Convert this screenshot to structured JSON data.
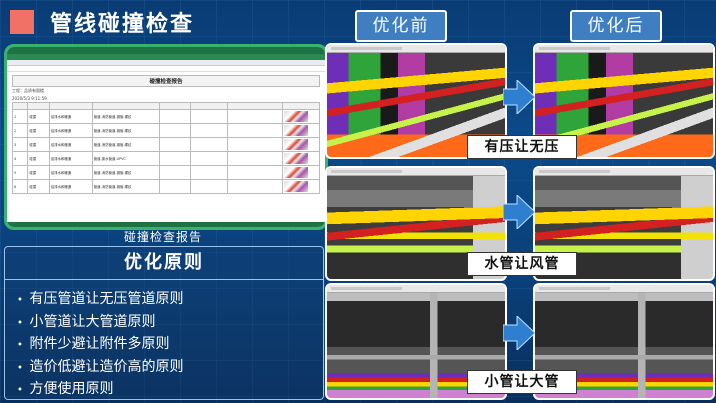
{
  "page": {
    "title": "管线碰撞检查"
  },
  "report": {
    "caption": "碰撞检查报告",
    "sheet_title": "碰撞检查报告",
    "meta_lines": [
      "工程：品质有限楼",
      "2020/5/3 9:11:59"
    ],
    "columns": [
      "",
      "",
      "",
      "",
      "",
      "",
      "",
      "",
      ""
    ],
    "rows": [
      {
        "no": "1",
        "type": "碰撞",
        "a": "给排水和暖通",
        "b": "管道-消防管道-钢管-螺纹",
        "c": "",
        "d": "",
        "e": "",
        "f": ""
      },
      {
        "no": "2",
        "type": "碰撞",
        "a": "给排水和暖通",
        "b": "管道-消防管道-钢管-螺纹",
        "c": "",
        "d": "",
        "e": "",
        "f": ""
      },
      {
        "no": "3",
        "type": "碰撞",
        "a": "给排水和暖通",
        "b": "管道-消防管道-钢管-螺纹",
        "c": "",
        "d": "",
        "e": "",
        "f": ""
      },
      {
        "no": "4",
        "type": "碰撞",
        "a": "给排水和暖通",
        "b": "管道-废水管道-UPVC",
        "c": "",
        "d": "",
        "e": "",
        "f": ""
      },
      {
        "no": "5",
        "type": "碰撞",
        "a": "给排水和暖通",
        "b": "管道-消防管道-钢管-螺纹",
        "c": "",
        "d": "",
        "e": "",
        "f": ""
      },
      {
        "no": "6",
        "type": "碰撞",
        "a": "给排水和暖通",
        "b": "管道-消防管道-钢管-螺纹",
        "c": "",
        "d": "",
        "e": "",
        "f": ""
      }
    ]
  },
  "principles": {
    "heading": "优化原则",
    "items": [
      "有压管道让无压管道原则",
      "小管道让大管道原则",
      "附件少避让附件多原则",
      "造价低避让造价高的原则",
      "方便使用原则"
    ]
  },
  "compare": {
    "before_label": "优化前",
    "after_label": "优化后",
    "cases": [
      {
        "label": "有压让无压"
      },
      {
        "label": "水管让风管"
      },
      {
        "label": "小管让大管"
      }
    ]
  },
  "colors": {
    "title_mark": "#f27166",
    "card_border": "#38b26c",
    "header_bg": "#3f7fc1",
    "arrow": "#2f7fd0"
  },
  "icons": {
    "arrow": "right-arrow-icon"
  }
}
